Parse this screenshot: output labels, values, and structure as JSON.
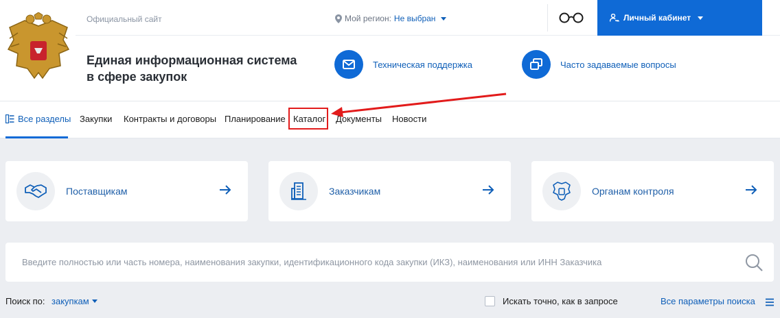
{
  "header": {
    "official_label": "Официальный сайт",
    "region_label": "Мой регион:",
    "region_value": "Не выбран",
    "cabinet_label": "Личный кабинет",
    "site_title_line1": "Единая информационная система",
    "site_title_line2": "в сфере закупок",
    "support_label": "Техническая поддержка",
    "faq_label": "Часто задаваемые вопросы"
  },
  "nav": {
    "items": [
      {
        "label": "Все разделы",
        "active": true
      },
      {
        "label": "Закупки"
      },
      {
        "label": "Контракты и договоры"
      },
      {
        "label": "Планирование"
      },
      {
        "label": "Каталог",
        "highlighted": true
      },
      {
        "label": "Документы"
      },
      {
        "label": "Новости"
      }
    ]
  },
  "cards": [
    {
      "label": "Поставщикам",
      "icon": "handshake-icon"
    },
    {
      "label": "Заказчикам",
      "icon": "building-icon"
    },
    {
      "label": "Органам контроля",
      "icon": "emblem-icon"
    }
  ],
  "search": {
    "placeholder": "Введите полностью или часть номера, наименования закупки, идентификационного кода закупки (ИКЗ), наименования или ИНН Заказчика"
  },
  "filters": {
    "search_by_label": "Поиск по:",
    "search_by_value": "закупкам",
    "exact_label": "Искать точно, как в запросе",
    "all_params_label": "Все параметры поиска"
  },
  "colors": {
    "brand": "#0f6ad6",
    "link": "#0f5fb8",
    "annotation": "#e21b1b",
    "page_bg": "#eceef2"
  }
}
